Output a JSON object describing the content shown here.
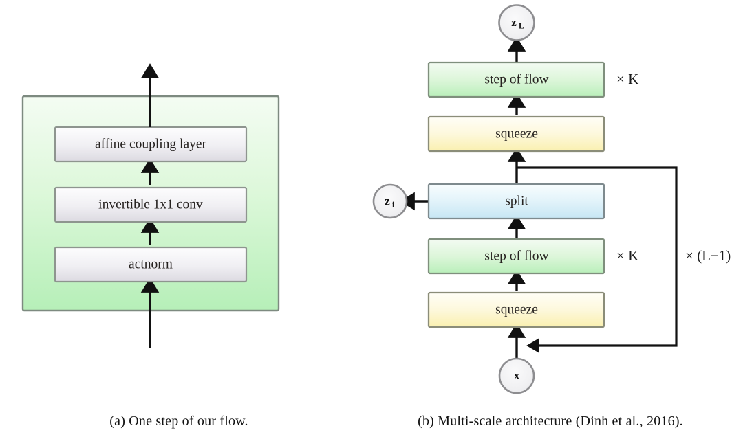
{
  "figure": {
    "kind": "two-panel-architecture-diagram"
  },
  "colors": {
    "box_border": "#7f8a80",
    "box_border_dark": "#6f7a72",
    "grey_fill_top": "#fbfbfc",
    "grey_fill_bottom": "#dedce2",
    "green_fill_top": "#f2fbf1",
    "green_fill_bottom": "#b9f0ba",
    "yellow_fill_top": "#fefdf4",
    "yellow_fill_bottom": "#fbf3b8",
    "blue_fill_top": "#f6fcfe",
    "blue_fill_bottom": "#cbe8f5",
    "circle_fill": "#f0f0f2",
    "circle_border": "#8d8d90",
    "arrow": "#111111",
    "text": "#262220"
  },
  "panel_a": {
    "caption": "(a) One step of our flow.",
    "container": {
      "name": "flow-step-container"
    },
    "blocks": [
      {
        "label": "affine coupling layer",
        "style": "grey"
      },
      {
        "label": "invertible 1x1 conv",
        "style": "grey"
      },
      {
        "label": "actnorm",
        "style": "grey"
      }
    ]
  },
  "panel_b": {
    "caption": "(b) Multi-scale architecture (Dinh et al., 2016).",
    "nodes": {
      "output": "z",
      "output_sub": "L",
      "split_out": "z",
      "split_out_sub": "i",
      "input": "x"
    },
    "blocks": [
      {
        "label": "step of flow",
        "style": "green"
      },
      {
        "label": "squeeze",
        "style": "yellow"
      },
      {
        "label": "split",
        "style": "blue"
      },
      {
        "label": "step of flow",
        "style": "green"
      },
      {
        "label": "squeeze",
        "style": "yellow"
      }
    ],
    "annotations": [
      {
        "label": "× K",
        "name": "multiplier-k-top"
      },
      {
        "label": "× K",
        "name": "multiplier-k-bottom"
      },
      {
        "label": "× (L−1)",
        "name": "multiplier-l-minus-1"
      }
    ]
  }
}
